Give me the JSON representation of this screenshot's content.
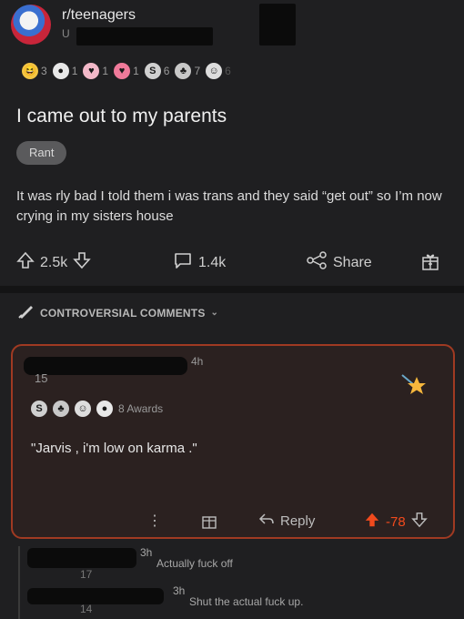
{
  "post": {
    "subreddit": "r/teenagers",
    "author_initial": "U",
    "awards": [
      {
        "icon": "laughing-face-icon",
        "count": "3",
        "color": "#f4c542"
      },
      {
        "icon": "snoo-icon",
        "count": "1",
        "color": "#e8e8e8"
      },
      {
        "icon": "heart-shield-icon",
        "count": "1",
        "color": "#f2b8c8"
      },
      {
        "icon": "heart-eyes-icon",
        "count": "1",
        "color": "#f07a9a"
      },
      {
        "icon": "silver-coin-icon",
        "count": "6",
        "color": "#d0d0d0"
      },
      {
        "icon": "group-icon",
        "count": "7",
        "color": "#c8c8c8"
      },
      {
        "icon": "rocket-face-icon",
        "count": "6",
        "color": "#dddddd"
      }
    ],
    "title": "I came out to my parents",
    "flair": "Rant",
    "body": "It was rly bad I told them i was trans and they said “get out” so I’m now crying in my sisters house",
    "upvotes": "2.5k",
    "comments": "1.4k",
    "share_label": "Share"
  },
  "sort": {
    "label": "CONTROVERSIAL COMMENTS"
  },
  "comment": {
    "time": "4h",
    "score_label": "15",
    "awards_label": "8 Awards",
    "text": "\"Jarvis , i'm low on karma .\"",
    "reply_label": "Reply",
    "score": "-78",
    "accent": "#a03a22"
  },
  "replies": [
    {
      "time": "3h",
      "text": "Actually fuck off",
      "count": "17"
    },
    {
      "time": "3h",
      "text": "Shut the actual fuck up.",
      "count": "14"
    }
  ]
}
